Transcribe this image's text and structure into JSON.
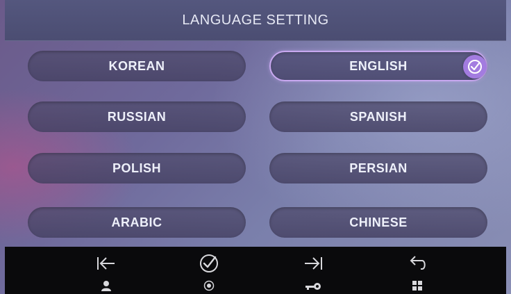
{
  "header": {
    "title": "LANGUAGE SETTING"
  },
  "languages": [
    {
      "label": "KOREAN"
    },
    {
      "label": "ENGLISH",
      "selected": true
    },
    {
      "label": "RUSSIAN"
    },
    {
      "label": "SPANISH"
    },
    {
      "label": "POLISH"
    },
    {
      "label": "PERSIAN"
    },
    {
      "label": "ARABIC"
    },
    {
      "label": "CHINESE"
    }
  ],
  "bottom_nav": [
    {
      "icon": "back-to-start-icon",
      "sub_icon": "user-icon"
    },
    {
      "icon": "check-icon",
      "sub_icon": "record-icon"
    },
    {
      "icon": "forward-to-end-icon",
      "sub_icon": "key-icon"
    },
    {
      "icon": "return-icon",
      "sub_icon": "grid-icon"
    }
  ],
  "colors": {
    "accent": "#a37ce0",
    "selected_border": "#c8a8f0",
    "header_bg": "#4b4d72",
    "bottom_bar_bg": "#0a0a0c"
  }
}
